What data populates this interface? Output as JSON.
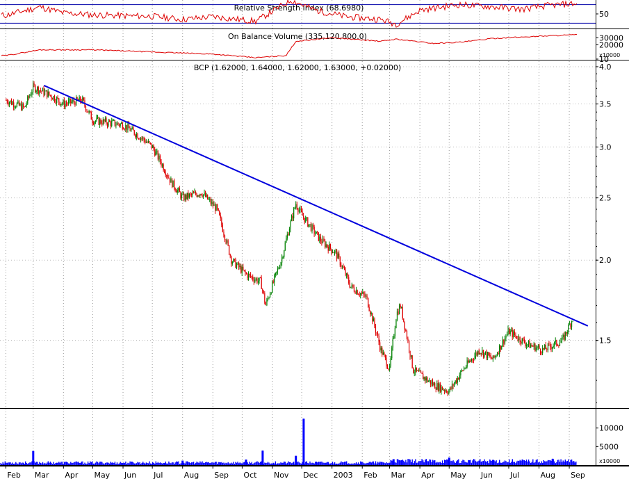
{
  "chart_data": [
    {
      "panel": "rsi",
      "type": "line",
      "title": "Relative Strength Index (68.6980)",
      "ylim": [
        20,
        80
      ],
      "yticks": [
        50
      ],
      "reference_levels": [
        30,
        70
      ],
      "series": [
        {
          "name": "Relative Strength Index",
          "color": "#dd0000",
          "x": [
            "2002-02-01",
            "2002-03-08",
            "2002-04-01",
            "2002-05-01",
            "2002-06-01",
            "2002-07-01",
            "2002-08-01",
            "2002-09-01",
            "2002-10-15",
            "2002-11-20",
            "2002-12-15",
            "2003-01-15",
            "2003-02-20",
            "2003-03-08",
            "2003-04-01",
            "2003-05-10",
            "2003-06-10",
            "2003-07-15",
            "2003-08-10",
            "2003-09-05"
          ],
          "values": [
            47,
            65,
            52,
            48,
            46,
            45,
            38,
            44,
            34,
            80,
            58,
            44,
            38,
            28,
            58,
            70,
            66,
            60,
            68,
            72
          ]
        }
      ]
    },
    {
      "panel": "obv",
      "type": "line",
      "title": "On Balance Volume (335,120,800.0)",
      "ylim": [
        0,
        40000
      ],
      "yticks": [
        10,
        20000,
        30000
      ],
      "unit_label": "x10000",
      "series": [
        {
          "name": "On Balance Volume",
          "color": "#dd0000",
          "x": [
            "2002-02-01",
            "2002-03-08",
            "2002-05-01",
            "2002-07-01",
            "2002-09-01",
            "2002-10-15",
            "2002-11-15",
            "2002-11-25",
            "2003-01-01",
            "2003-02-20",
            "2003-03-08",
            "2003-04-15",
            "2003-05-15",
            "2003-06-15",
            "2003-07-15",
            "2003-08-15",
            "2003-09-05"
          ],
          "values": [
            5000,
            13000,
            13000,
            10000,
            7000,
            2000,
            5000,
            25000,
            30000,
            25000,
            28000,
            22000,
            24000,
            29000,
            31000,
            33000,
            34000
          ]
        }
      ]
    },
    {
      "panel": "price",
      "type": "candlestick",
      "title": "BCP (1.62000, 1.64000, 1.62000, 1.63000, +0.02000)",
      "ylim": [
        1.18,
        4.08
      ],
      "y_scale": "log",
      "yticks": [
        1.5,
        2.0,
        2.5,
        3.0,
        3.5,
        4.0
      ],
      "up_color": "#008000",
      "down_color": "#dd0000",
      "close_path": {
        "x": [
          "2002-02-01",
          "2002-02-20",
          "2002-03-01",
          "2002-03-20",
          "2002-04-01",
          "2002-04-20",
          "2002-05-01",
          "2002-06-01",
          "2002-06-20",
          "2002-07-01",
          "2002-07-20",
          "2002-08-01",
          "2002-08-20",
          "2002-09-05",
          "2002-09-20",
          "2002-10-05",
          "2002-10-20",
          "2002-10-25",
          "2002-11-10",
          "2002-11-25",
          "2002-12-01",
          "2002-12-20",
          "2003-01-05",
          "2003-01-20",
          "2003-02-05",
          "2003-02-20",
          "2003-03-01",
          "2003-03-08",
          "2003-03-12",
          "2003-03-25",
          "2003-04-15",
          "2003-05-01",
          "2003-05-15",
          "2003-06-01",
          "2003-06-15",
          "2003-07-01",
          "2003-07-20",
          "2003-08-05",
          "2003-08-25",
          "2003-09-05"
        ],
        "values": [
          3.55,
          3.45,
          3.72,
          3.6,
          3.5,
          3.55,
          3.3,
          3.25,
          3.1,
          3.0,
          2.65,
          2.5,
          2.55,
          2.4,
          2.0,
          1.9,
          1.85,
          1.7,
          2.0,
          2.45,
          2.35,
          2.15,
          2.05,
          1.82,
          1.75,
          1.45,
          1.35,
          1.65,
          1.7,
          1.35,
          1.28,
          1.25,
          1.35,
          1.45,
          1.4,
          1.55,
          1.48,
          1.45,
          1.5,
          1.63
        ]
      },
      "trendline": {
        "color": "#0000dd",
        "points": [
          [
            "2002-03-12",
            3.74
          ],
          [
            "2003-09-20",
            1.58
          ]
        ]
      }
    },
    {
      "panel": "volume",
      "type": "bar",
      "unit_label": "x10000",
      "ylim": [
        0,
        15000
      ],
      "yticks": [
        5000,
        10000
      ],
      "color": "#0000ff",
      "spikes": {
        "x": [
          "2002-03-01",
          "2002-08-01",
          "2002-10-05",
          "2002-10-22",
          "2002-11-25",
          "2002-12-03",
          "2003-03-05",
          "2003-05-01",
          "2003-06-15",
          "2003-08-15"
        ],
        "values": [
          3800,
          1200,
          1500,
          3900,
          2500,
          12500,
          1600,
          2000,
          1400,
          1700
        ]
      },
      "baseline": 800
    }
  ],
  "x_axis": {
    "labels": [
      "Feb",
      "Mar",
      "Apr",
      "May",
      "Jun",
      "Jul",
      "Aug",
      "Sep",
      "Oct",
      "Nov",
      "Dec",
      "2003",
      "Feb",
      "Mar",
      "Apr",
      "May",
      "Jun",
      "Jul",
      "Aug",
      "Sep"
    ],
    "dates": [
      "2002-02-01",
      "2002-03-01",
      "2002-04-01",
      "2002-05-01",
      "2002-06-01",
      "2002-07-01",
      "2002-08-01",
      "2002-09-01",
      "2002-10-01",
      "2002-11-01",
      "2002-12-01",
      "2003-01-01",
      "2003-02-01",
      "2003-03-01",
      "2003-04-01",
      "2003-05-01",
      "2003-06-01",
      "2003-07-01",
      "2003-08-01",
      "2003-09-01"
    ]
  }
}
